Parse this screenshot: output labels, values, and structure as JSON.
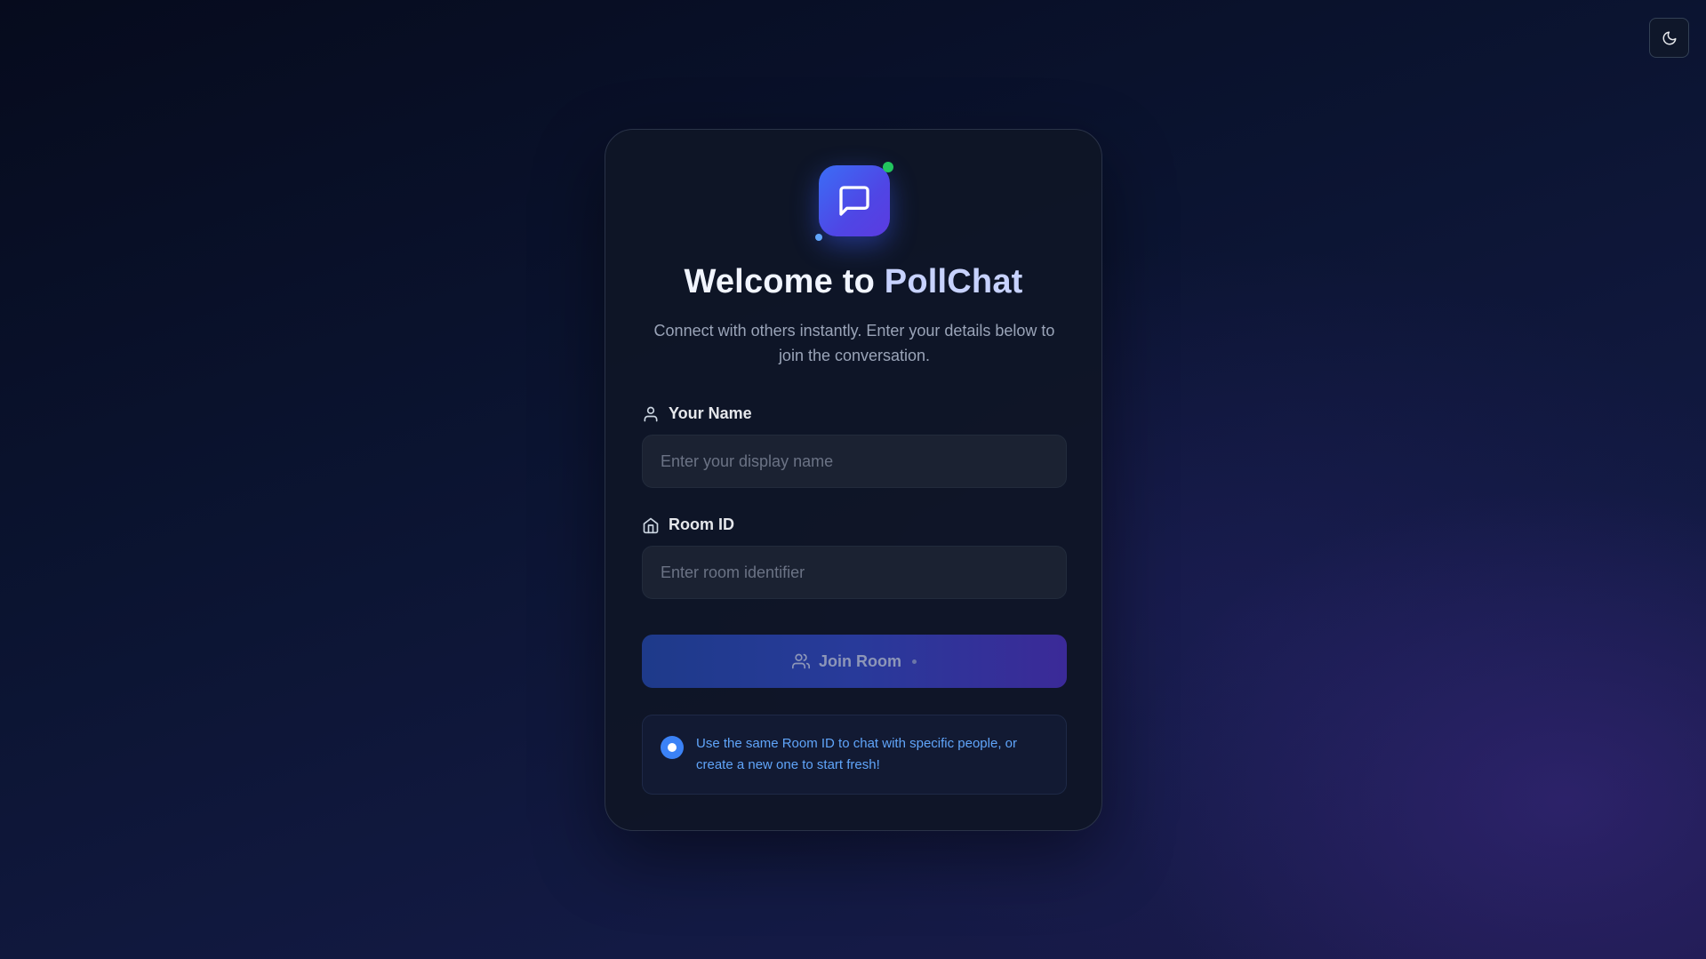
{
  "theme_toggle": {
    "icon": "moon-icon"
  },
  "logo": {
    "icon": "message-square-icon",
    "status_color": "#22c55e"
  },
  "heading": {
    "prefix": "Welcome to ",
    "brand": "PollChat"
  },
  "subtitle": "Connect with others instantly. Enter your details below to join the conversation.",
  "name_field": {
    "label": "Your Name",
    "icon": "user-icon",
    "placeholder": "Enter your display name",
    "value": ""
  },
  "room_field": {
    "label": "Room ID",
    "icon": "home-icon",
    "placeholder": "Enter room identifier",
    "value": ""
  },
  "join_button": {
    "label": "Join Room",
    "icon": "users-icon"
  },
  "info": {
    "icon": "info-dot-icon",
    "text": "Use the same Room ID to chat with specific people, or create a new one to start fresh!"
  },
  "colors": {
    "accent": "#3b82f6",
    "brand_gradient_start": "#3b6df6",
    "brand_gradient_end": "#5b3be0",
    "info_text": "#60a5fa"
  }
}
